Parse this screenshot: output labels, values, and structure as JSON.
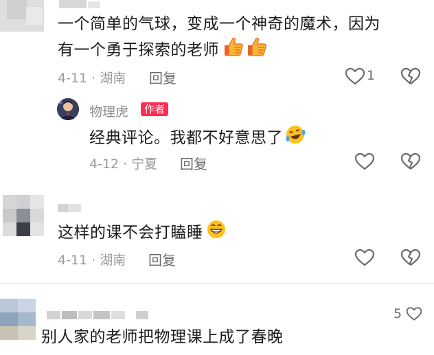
{
  "comments": [
    {
      "text_line1": "一个简单的气球，变成一个神奇的魔术，因为",
      "text_line2": "有一个勇于探索的老师",
      "date_location": "4-11 · 湖南",
      "reply_label": "回复",
      "like_count": "1",
      "reply": {
        "author": "物理虎",
        "author_badge": "作者",
        "text": "经典评论。我都不好意思了",
        "date_location": "4-12 · 宁夏",
        "reply_label": "回复"
      }
    },
    {
      "text": "这样的课不会打瞌睡",
      "date_location": "4-11 · 湖南",
      "reply_label": "回复"
    },
    {
      "text": "别人家的老师把物理课上成了春晚",
      "like_count": "5"
    }
  ],
  "icons": {
    "like": "heart-outline-icon",
    "dislike": "broken-heart-icon",
    "thumbs_up": "thumbs-up-emoji",
    "laugh": "laughing-emoji",
    "grin": "grinning-emoji"
  },
  "colors": {
    "author_badge": "#fe2c55",
    "meta_text": "#9a9a9a",
    "icon": "#6b6b6b"
  }
}
